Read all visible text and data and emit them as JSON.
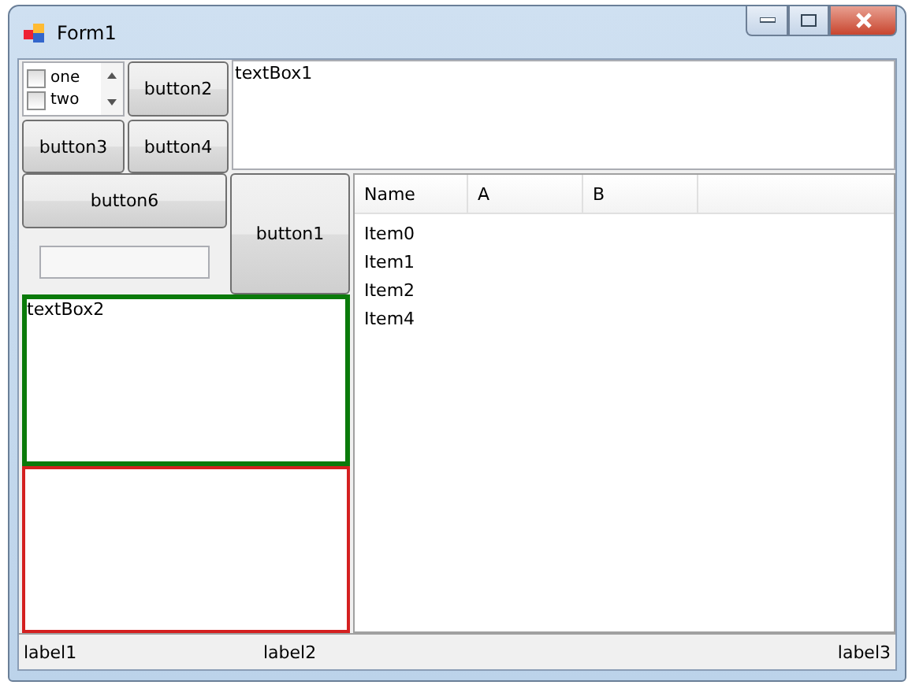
{
  "window": {
    "title": "Form1"
  },
  "checklist": [
    {
      "label": "one",
      "checked": false
    },
    {
      "label": "two",
      "checked": false
    }
  ],
  "buttons_top": [
    "button2",
    "button3",
    "button4"
  ],
  "text_box_1": {
    "value": "textBox1"
  },
  "button6": "button6",
  "button1": "button1",
  "text_box_2": {
    "value": "textBox2"
  },
  "list_view": {
    "columns": [
      "Name",
      "A",
      "B"
    ],
    "items": [
      "Item0",
      "Item1",
      "Item2",
      "Item4"
    ]
  },
  "labels": [
    "label1",
    "label2",
    "label3"
  ]
}
